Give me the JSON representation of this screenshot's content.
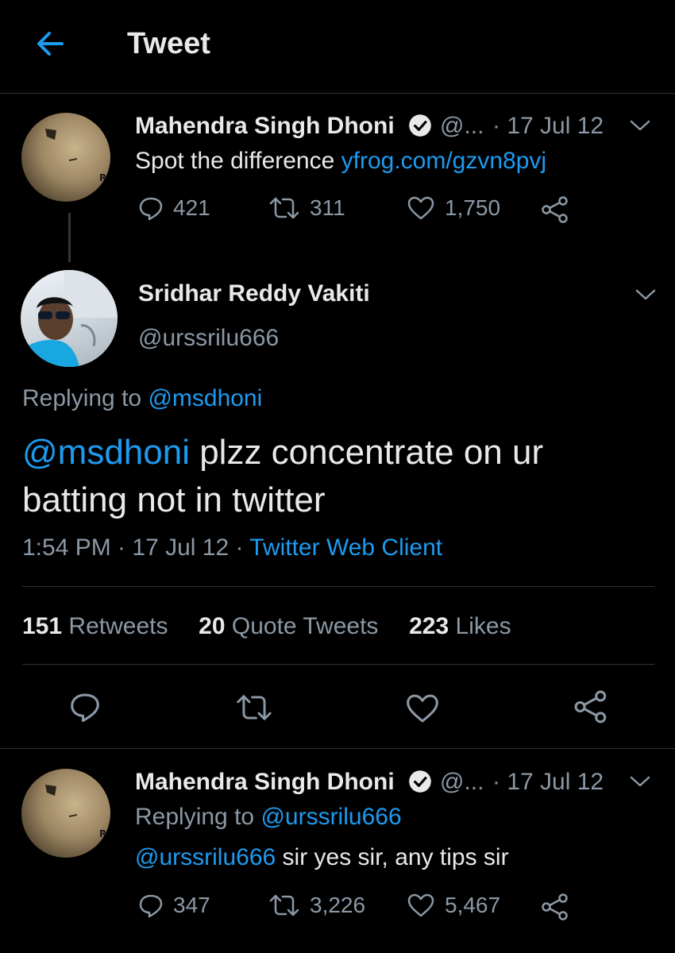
{
  "header": {
    "title": "Tweet"
  },
  "parent_tweet": {
    "name": "Mahendra Singh Dhoni",
    "handle": "@...",
    "date": "· 17 Jul 12",
    "text": "Spot the difference ",
    "link": "yfrog.com/gzvn8pvj",
    "replies": "421",
    "retweets": "311",
    "likes": "1,750"
  },
  "main_tweet": {
    "name": "Sridhar Reddy Vakiti",
    "handle": "@urssrilu666",
    "replying_prefix": "Replying to ",
    "replying_to": "@msdhoni",
    "text_mention": "@msdhoni",
    "text_line1": " plzz concentrate on ur",
    "text_line2": "batting not in twitter",
    "timestamp": "1:54 PM · 17 Jul 12 · ",
    "client": "Twitter Web Client",
    "stats": {
      "retweets_count": "151",
      "retweets_label": "Retweets",
      "quotes_count": "20",
      "quotes_label": "Quote Tweets",
      "likes_count": "223",
      "likes_label": "Likes"
    }
  },
  "reply_tweet": {
    "name": "Mahendra Singh Dhoni",
    "handle": "@...",
    "date": "· 17 Jul 12",
    "replying_prefix": "Replying to ",
    "replying_to": "@urssrilu666",
    "text_mention": "@urssrilu666",
    "text": " sir yes sir, any tips sir",
    "replies": "347",
    "retweets": "3,226",
    "likes": "5,467"
  },
  "colors": {
    "accent": "#1d9bf0",
    "background": "#000000",
    "muted": "#8b98a5"
  },
  "icons": [
    "back-arrow-icon",
    "verified-badge-icon",
    "chevron-down-icon",
    "reply-icon",
    "retweet-icon",
    "like-icon",
    "share-icon"
  ]
}
